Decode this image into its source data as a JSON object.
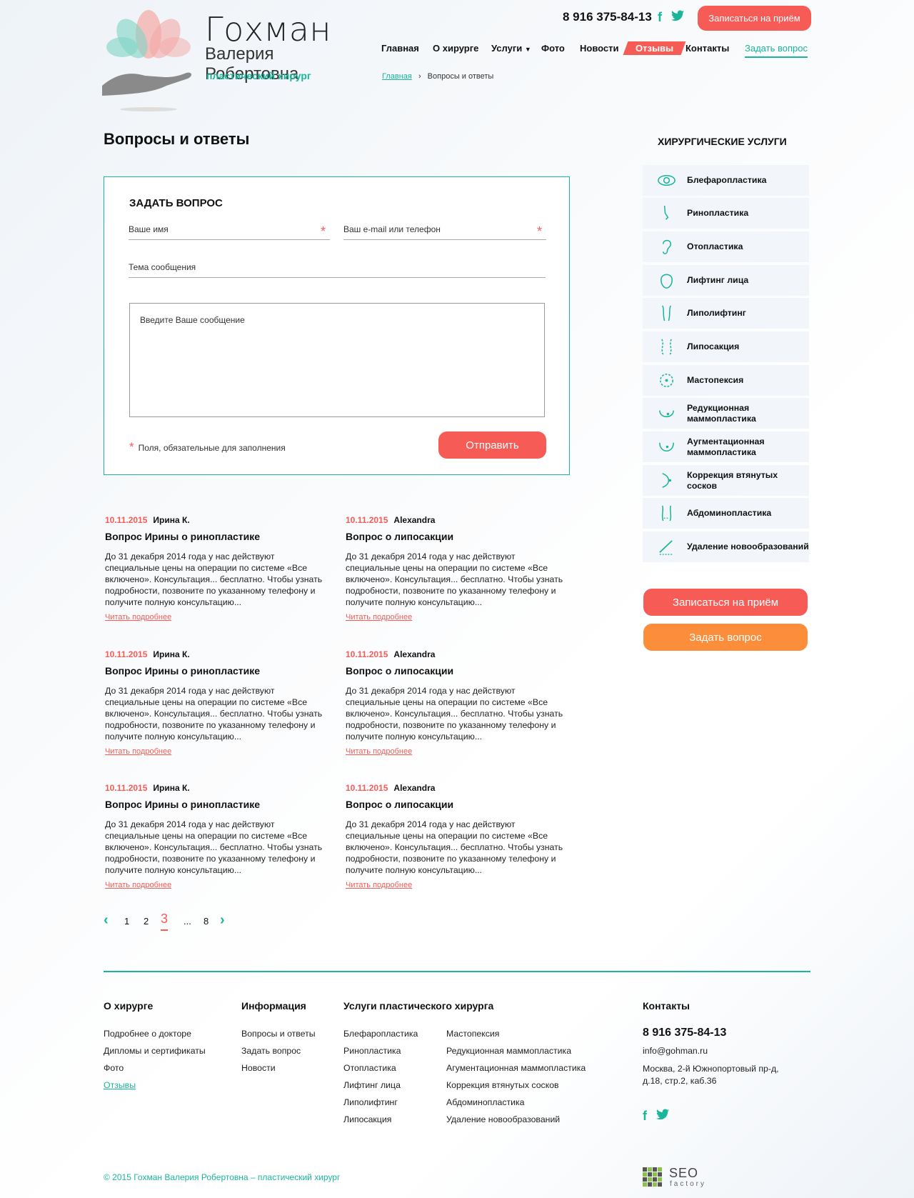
{
  "brand": {
    "surname": "Гохман",
    "name": "Валерия Робертовна",
    "profession": "пластический хирург",
    "accent": "#1bb69a",
    "red": "#f65b56",
    "orange": "#fb8d3b"
  },
  "header": {
    "phone": "8 916 375-84-13",
    "cta": "Записаться на приём",
    "nav": [
      "Главная",
      "О хирурге",
      "Услуги",
      "Фото",
      "Новости",
      "Отзывы",
      "Контакты",
      "Задать вопрос"
    ]
  },
  "breadcrumb": {
    "home": "Главная",
    "current": "Вопросы и ответы"
  },
  "page_title": "Вопросы и ответы",
  "form": {
    "title": "ЗАДАТЬ ВОПРОС",
    "name_placeholder": "Ваше имя",
    "contact_placeholder": "Ваш e-mail или телефон",
    "subject_placeholder": "Тема сообщения",
    "message_placeholder": "Введите Ваше сообщение",
    "required_note": "Поля, обязательные для заполнения",
    "submit": "Отправить",
    "required_mark": "*"
  },
  "qa_items": [
    {
      "date": "10.11.2015",
      "author": "Ирина К.",
      "title": "Вопрос Ирины о ринопластике",
      "text": "До 31 декабря 2014 года у нас действуют специальные цены на операции по системе «Все включено». Консультация... бесплатно. Чтобы узнать подробности, позвоните по указанному телефону и получите полную консультацию...",
      "more": "Читать подробнее"
    },
    {
      "date": "10.11.2015",
      "author": "Alexandra",
      "title": "Вопрос о липосакции",
      "text": "До 31 декабря 2014 года у нас действуют специальные цены на операции по системе «Все включено». Консультация... бесплатно. Чтобы узнать подробности, позвоните по указанному телефону и получите полную консультацию...",
      "more": "Читать подробнее"
    },
    {
      "date": "10.11.2015",
      "author": "Ирина К.",
      "title": "Вопрос Ирины о ринопластике",
      "text": "До 31 декабря 2014 года у нас действуют специальные цены на операции по системе «Все включено». Консультация... бесплатно. Чтобы узнать подробности, позвоните по указанному телефону и получите полную консультацию...",
      "more": "Читать подробнее"
    },
    {
      "date": "10.11.2015",
      "author": "Alexandra",
      "title": "Вопрос о липосакции",
      "text": "До 31 декабря 2014 года у нас действуют специальные цены на операции по системе «Все включено». Консультация... бесплатно. Чтобы узнать подробности, позвоните по указанному телефону и получите полную консультацию...",
      "more": "Читать подробнее"
    },
    {
      "date": "10.11.2015",
      "author": "Ирина К.",
      "title": "Вопрос Ирины о ринопластике",
      "text": "До 31 декабря 2014 года у нас действуют специальные цены на операции по системе «Все включено». Консультация... бесплатно. Чтобы узнать подробности, позвоните по указанному телефону и получите полную консультацию...",
      "more": "Читать подробнее"
    },
    {
      "date": "10.11.2015",
      "author": "Alexandra",
      "title": "Вопрос о липосакции",
      "text": "До 31 декабря 2014 года у нас действуют специальные цены на операции по системе «Все включено». Консультация... бесплатно. Чтобы узнать подробности, позвоните по указанному телефону и получите полную консультацию...",
      "more": "Читать подробнее"
    }
  ],
  "pager": {
    "prev": "‹",
    "p1": "1",
    "p2": "2",
    "current": "3",
    "ellipsis": "...",
    "last": "8",
    "next": "›"
  },
  "sidebar": {
    "title": "ХИРУРГИЧЕСКИЕ УСЛУГИ",
    "items": [
      {
        "label": "Блефаропластика",
        "icon": "eye-icon"
      },
      {
        "label": "Ринопластика",
        "icon": "nose-icon"
      },
      {
        "label": "Отопластика",
        "icon": "ear-icon"
      },
      {
        "label": "Лифтинг лица",
        "icon": "face-icon"
      },
      {
        "label": "Липолифтинг",
        "icon": "body-contour-icon"
      },
      {
        "label": "Липосакция",
        "icon": "waist-icon"
      },
      {
        "label": "Мастопексия",
        "icon": "breast-icon"
      },
      {
        "label": "Редукционная маммопластика",
        "icon": "breast-reduction-icon"
      },
      {
        "label": "Аугментационная маммопластика",
        "icon": "breast-augmentation-icon"
      },
      {
        "label": "Коррекция втянутых сосков",
        "icon": "nipple-icon"
      },
      {
        "label": "Абдоминопластика",
        "icon": "abdomen-icon"
      },
      {
        "label": "Удаление новообразований",
        "icon": "scalpel-icon"
      }
    ],
    "book": "Записаться на приём",
    "ask": "Задать вопрос"
  },
  "footer": {
    "col1_title": "О хирурге",
    "col1": [
      "Подробнее о докторе",
      "Дипломы и сертификаты",
      "Фото",
      "Отзывы"
    ],
    "col2_title": "Информация",
    "col2": [
      "Вопросы и ответы",
      "Задать вопрос",
      "Новости"
    ],
    "col3_title": "Услуги пластического хирурга",
    "col3a": [
      "Блефаропластика",
      "Ринопластика",
      "Отопластика",
      "Лифтинг лица",
      "Липолифтинг",
      "Липосакция"
    ],
    "col3b": [
      "Мастопексия",
      "Редукционная маммопластика",
      "Агументационная маммопластика",
      "Коррекция втянутых сосков",
      "Абдоминопластика",
      "Удаление новообразований"
    ],
    "col4_title": "Контакты",
    "phone": "8 916 375-84-13",
    "email": "info@gohman.ru",
    "address": "Москва, 2-й Южнопортовый пр-д, д.18, стр.2, каб.36",
    "copyright": "© 2015 Гохман Валерия Робертовна – пластический хирург",
    "seo_brand": "SEO",
    "seo_sub": "factory"
  }
}
